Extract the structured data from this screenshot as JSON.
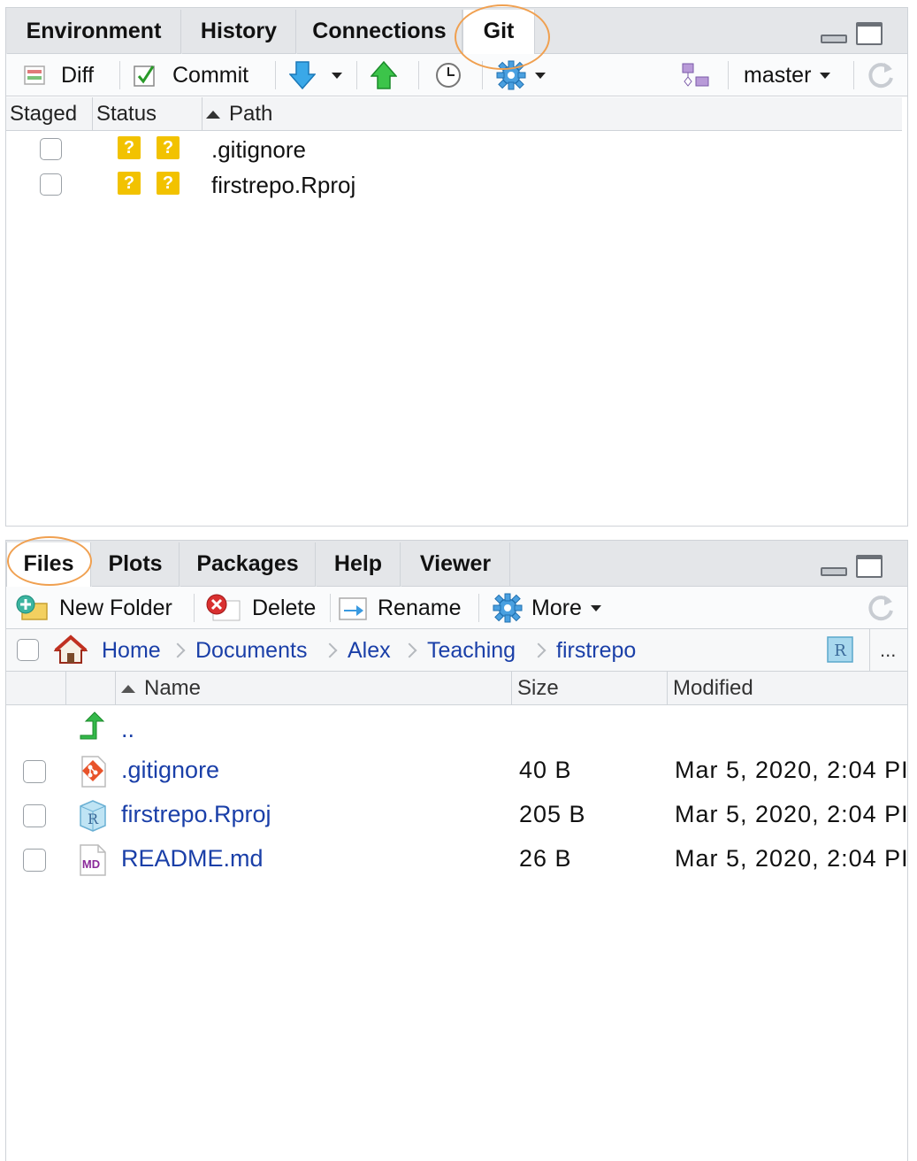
{
  "git_pane": {
    "tabs": [
      {
        "label": "Environment"
      },
      {
        "label": "History"
      },
      {
        "label": "Connections"
      },
      {
        "label": "Git"
      }
    ],
    "toolbar": {
      "diff_label": "Diff",
      "commit_label": "Commit",
      "branch": "master"
    },
    "columns": {
      "staged": "Staged",
      "status": "Status",
      "path": "Path"
    },
    "rows": [
      {
        "status_index": "?",
        "status_worktree": "?",
        "path": ".gitignore"
      },
      {
        "status_index": "?",
        "status_worktree": "?",
        "path": "firstrepo.Rproj"
      }
    ]
  },
  "files_pane": {
    "tabs": [
      {
        "label": "Files"
      },
      {
        "label": "Plots"
      },
      {
        "label": "Packages"
      },
      {
        "label": "Help"
      },
      {
        "label": "Viewer"
      }
    ],
    "toolbar": {
      "new_folder_label": "New Folder",
      "delete_label": "Delete",
      "rename_label": "Rename",
      "more_label": "More"
    },
    "breadcrumbs": [
      "Home",
      "Documents",
      "Alex",
      "Teaching",
      "firstrepo"
    ],
    "more_crumbs": "...",
    "columns": {
      "name": "Name",
      "size": "Size",
      "modified": "Modified"
    },
    "parent_dir": "..",
    "files": [
      {
        "name": ".gitignore",
        "size": "40 B",
        "modified": "Mar 5, 2020, 2:04 PI",
        "icon": "git-file-icon"
      },
      {
        "name": "firstrepo.Rproj",
        "size": "205 B",
        "modified": "Mar 5, 2020, 2:04 PI",
        "icon": "rproj-file-icon"
      },
      {
        "name": "README.md",
        "size": "26 B",
        "modified": "Mar 5, 2020, 2:04 PI",
        "icon": "markdown-file-icon"
      }
    ],
    "md_icon_text": "MD",
    "rproj_icon_text": "R"
  },
  "colors": {
    "link": "#1a3fa8",
    "highlight": "#f0a050",
    "status_untracked": "#f2c200"
  }
}
